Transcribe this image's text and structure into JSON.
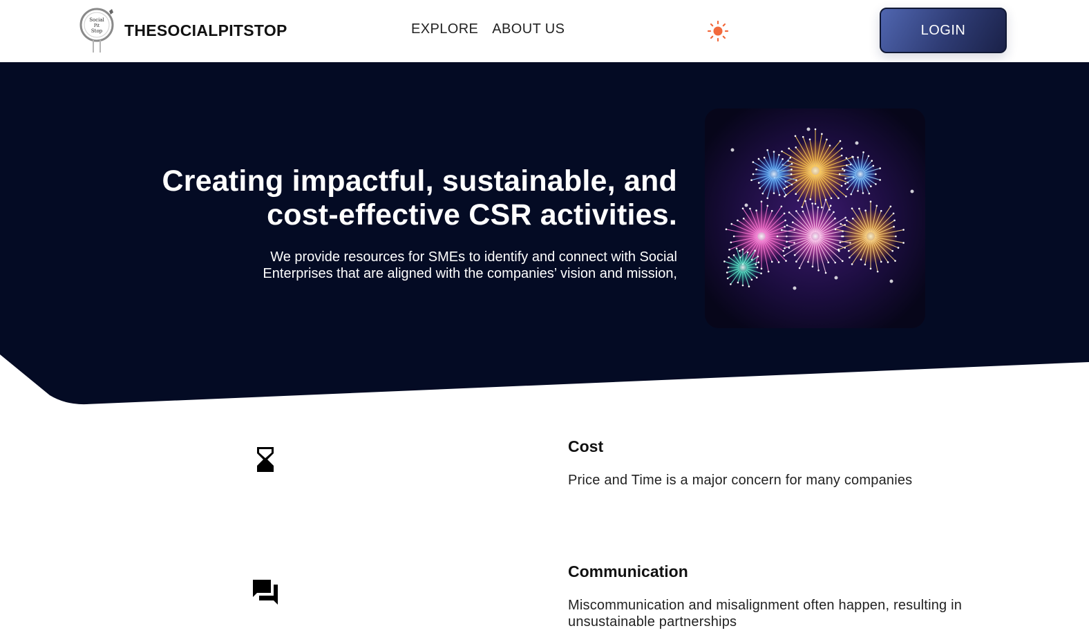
{
  "header": {
    "logo_text": [
      "Social",
      "Pit",
      "Stop"
    ],
    "brand": "THESOCIALPITSTOP",
    "nav": [
      {
        "label": "EXPLORE"
      },
      {
        "label": "ABOUT US"
      }
    ],
    "theme_toggle_icon": "sun-icon",
    "login_label": "LOGIN"
  },
  "hero": {
    "title_line1": "Creating impactful, sustainable, and",
    "title_line2": "cost-effective CSR activities.",
    "subtitle_line1": "We provide resources for SMEs to identify and connect with Social",
    "subtitle_line2": "Enterprises that are aligned with the companies’ vision and mission,",
    "image": "fireworks-image",
    "background_color": "#040b24"
  },
  "features": [
    {
      "icon": "hourglass-icon",
      "title": "Cost",
      "description": "Price and Time is a major concern for many companies"
    },
    {
      "icon": "chat-bubbles-icon",
      "title": "Communication",
      "description": "Miscommunication and misalignment often happen, resulting in unsustainable partnerships"
    }
  ],
  "colors": {
    "accent_sun": "#f26a3d",
    "login_gradient_start": "#5066b0",
    "login_gradient_end": "#1a2148"
  }
}
